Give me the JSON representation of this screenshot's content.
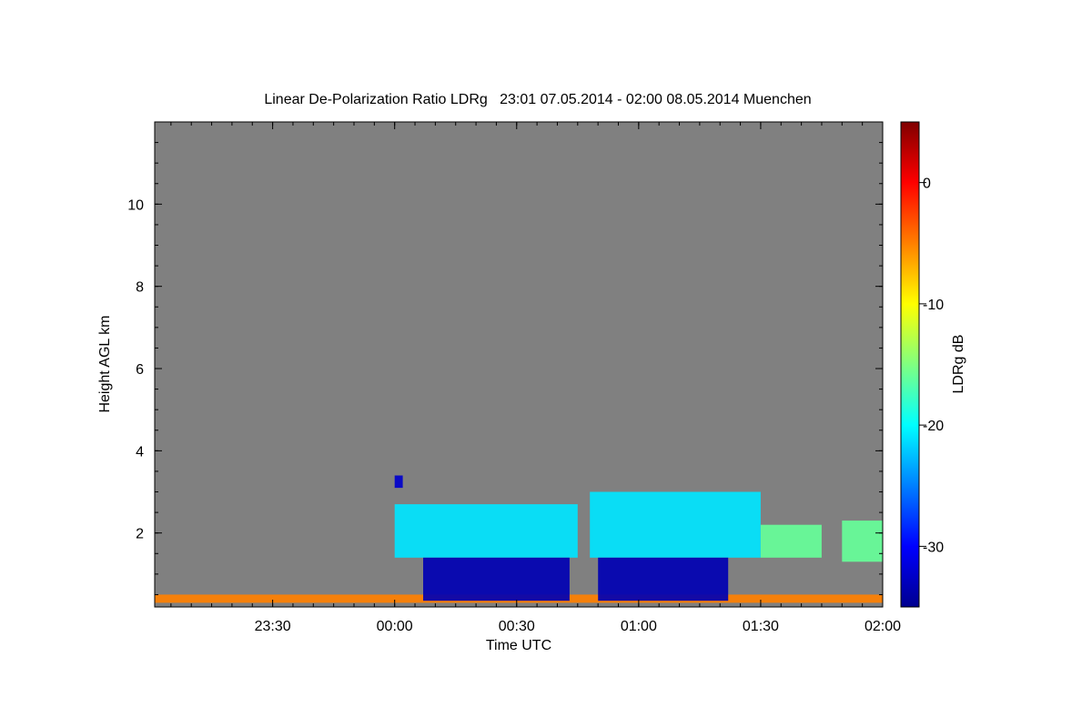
{
  "chart_data": {
    "type": "heatmap",
    "title": "Linear De-Polarization Ratio LDRg   23:01 07.05.2014 - 02:00 08.05.2014 Muenchen",
    "xlabel": "Time UTC",
    "ylabel": "Height AGL km",
    "xlim": [
      "23:01",
      "02:00"
    ],
    "ylim": [
      0.2,
      12.0
    ],
    "x_ticks": [
      {
        "t": "23:30",
        "label": "23:30"
      },
      {
        "t": "00:00",
        "label": "00:00"
      },
      {
        "t": "00:30",
        "label": "00:30"
      },
      {
        "t": "01:00",
        "label": "01:00"
      },
      {
        "t": "01:30",
        "label": "01:30"
      },
      {
        "t": "02:00",
        "label": "02:00"
      }
    ],
    "y_ticks": [
      {
        "v": 2,
        "label": "2"
      },
      {
        "v": 4,
        "label": "4"
      },
      {
        "v": 6,
        "label": "6"
      },
      {
        "v": 8,
        "label": "8"
      },
      {
        "v": 10,
        "label": "10"
      }
    ],
    "colorbar": {
      "label": "LDRg dB",
      "range": [
        -35,
        5
      ],
      "colormap": "jet",
      "ticks": [
        {
          "v": 0,
          "label": "0"
        },
        {
          "v": -10,
          "label": "-10"
        },
        {
          "v": -20,
          "label": "-20"
        },
        {
          "v": -30,
          "label": "-30"
        }
      ]
    },
    "background_color": "#808080",
    "regions": [
      {
        "name": "near-surface aerosol layer",
        "t_start": "23:01",
        "t_end": "02:00",
        "h_bottom": 0.3,
        "h_top": 0.5,
        "ldr_db": -5
      },
      {
        "name": "isolated echo",
        "t_start": "00:00",
        "t_end": "00:02",
        "h_bottom": 3.1,
        "h_top": 3.4,
        "ldr_db": -32
      },
      {
        "name": "cloud 1 mid layer",
        "t_start": "00:00",
        "t_end": "00:45",
        "h_bottom": 1.4,
        "h_top": 2.7,
        "ldr_db": -21
      },
      {
        "name": "cloud 1 low dense layer",
        "t_start": "00:07",
        "t_end": "00:43",
        "h_bottom": 0.35,
        "h_top": 1.4,
        "ldr_db": -33
      },
      {
        "name": "cloud 2 mid layer",
        "t_start": "00:48",
        "t_end": "01:30",
        "h_bottom": 1.4,
        "h_top": 3.0,
        "ldr_db": -21
      },
      {
        "name": "cloud 2 low dense layer",
        "t_start": "00:50",
        "t_end": "01:22",
        "h_bottom": 0.35,
        "h_top": 1.4,
        "ldr_db": -33
      },
      {
        "name": "trailing layer",
        "t_start": "01:30",
        "t_end": "01:45",
        "h_bottom": 1.4,
        "h_top": 2.2,
        "ldr_db": -16
      },
      {
        "name": "final layer",
        "t_start": "01:50",
        "t_end": "02:00",
        "h_bottom": 1.3,
        "h_top": 2.3,
        "ldr_db": -16
      }
    ]
  }
}
